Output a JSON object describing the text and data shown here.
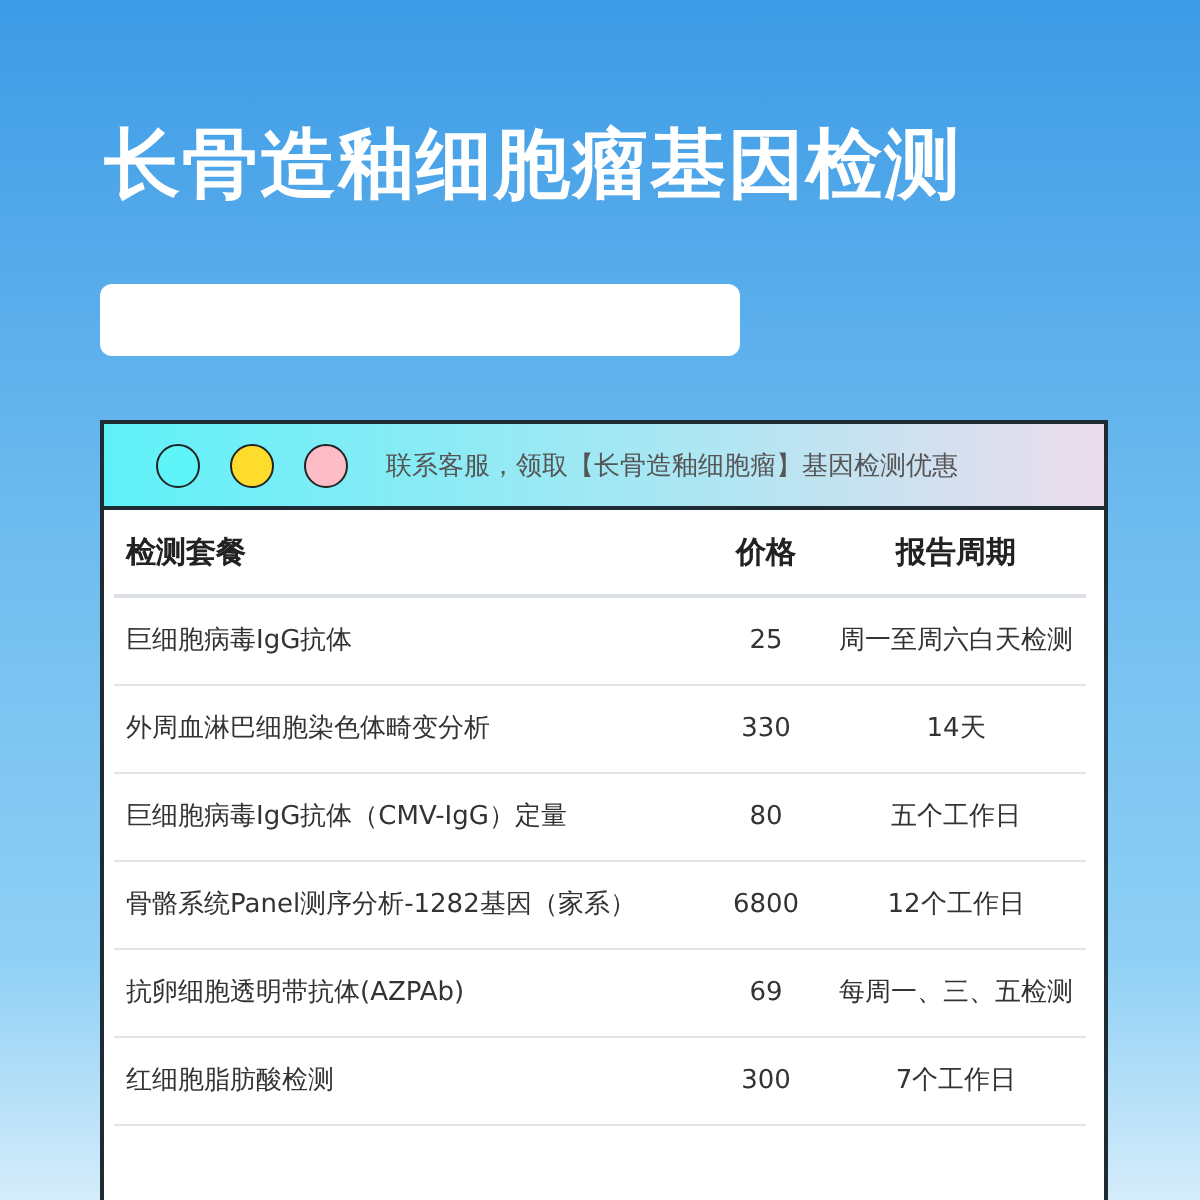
{
  "title": "长骨造釉细胞瘤基因检测",
  "card": {
    "dots": [
      {
        "color": "#5ff5f8"
      },
      {
        "color": "#fddc2c"
      },
      {
        "color": "#fdbcc6"
      }
    ],
    "notice": "联系客服，领取【长骨造釉细胞瘤】基因检测优惠"
  },
  "table": {
    "columns": [
      "检测套餐",
      "价格",
      "报告周期"
    ],
    "rows": [
      {
        "name": "巨细胞病毒IgG抗体",
        "price": "25",
        "period": "周一至周六白天检测"
      },
      {
        "name": "外周血淋巴细胞染色体畸变分析",
        "price": "330",
        "period": "14天"
      },
      {
        "name": "巨细胞病毒IgG抗体（CMV-IgG）定量",
        "price": "80",
        "period": "五个工作日"
      },
      {
        "name": "骨骼系统Panel测序分析-1282基因（家系）",
        "price": "6800",
        "period": "12个工作日"
      },
      {
        "name": "抗卵细胞透明带抗体(AZPAb)",
        "price": "69",
        "period": "每周一、三、五检测"
      },
      {
        "name": "红细胞脂肪酸检测",
        "price": "300",
        "period": "7个工作日"
      }
    ]
  }
}
